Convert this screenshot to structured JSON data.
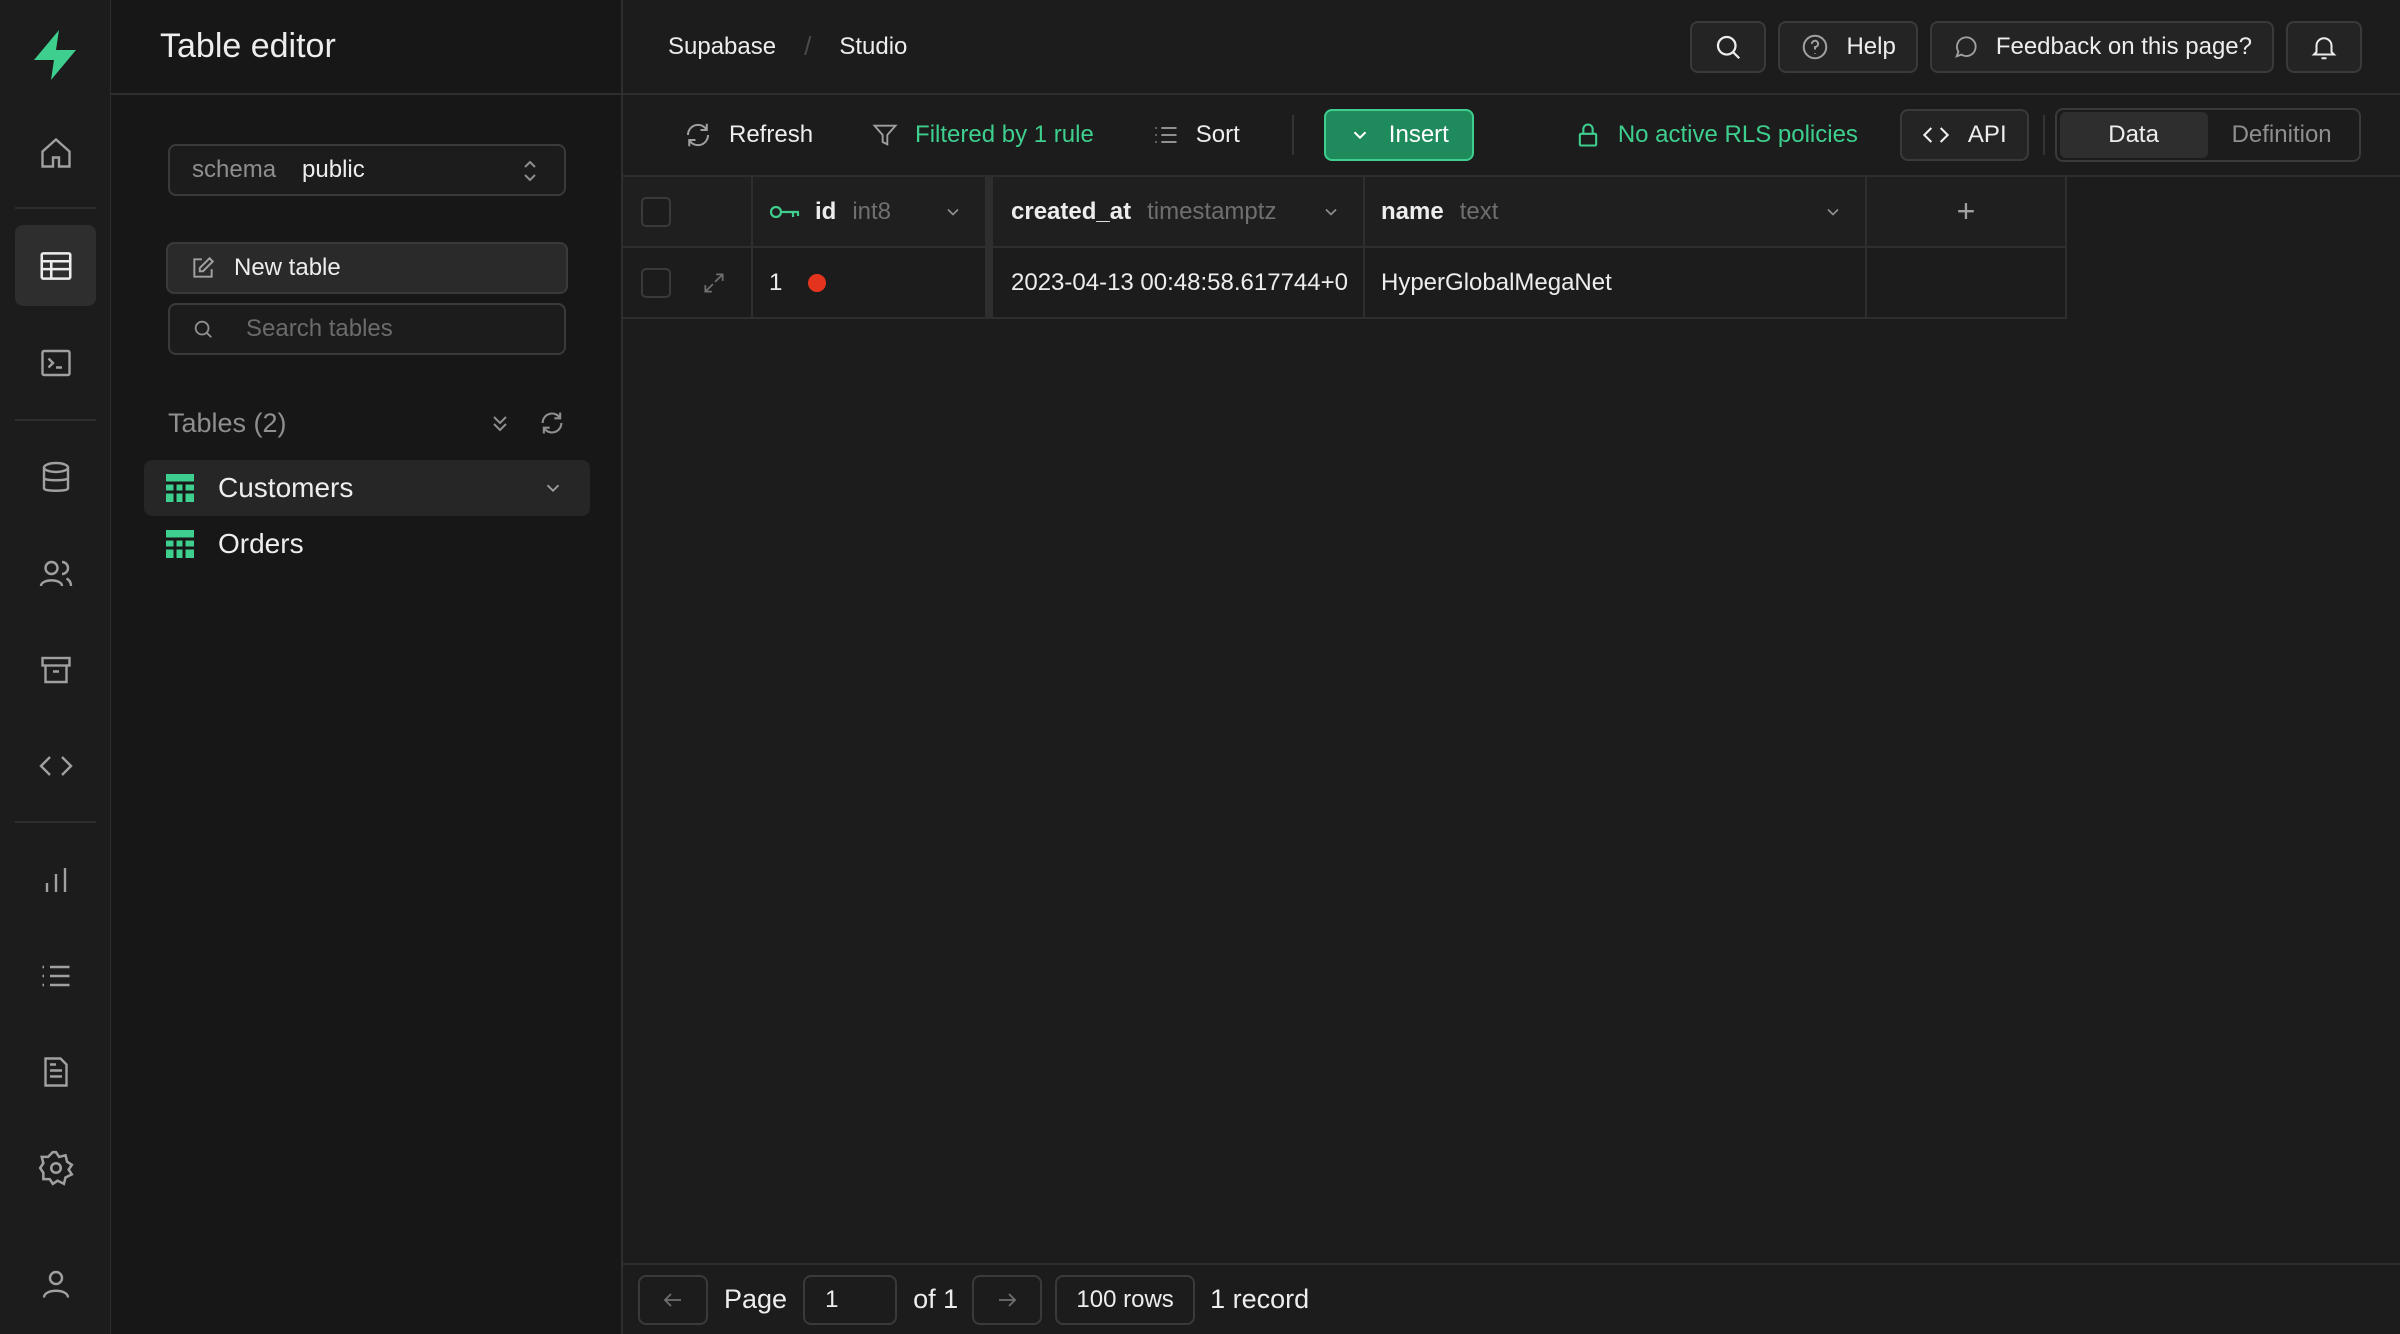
{
  "sidebar": {
    "title": "Table editor",
    "schema_label": "schema",
    "schema_value": "public",
    "new_table_label": "New table",
    "search_placeholder": "Search tables",
    "tables_header": "Tables (2)",
    "tables": [
      {
        "name": "Customers"
      },
      {
        "name": "Orders"
      }
    ]
  },
  "topbar": {
    "crumbs": [
      "Supabase",
      "/",
      "Studio"
    ],
    "help_label": "Help",
    "feedback_label": "Feedback on this page?"
  },
  "toolbar": {
    "refresh_label": "Refresh",
    "filter_label": "Filtered by 1 rule",
    "sort_label": "Sort",
    "insert_label": "Insert",
    "rls_label": "No active RLS policies",
    "api_label": "API",
    "tabs": [
      "Data",
      "Definition"
    ],
    "active_tab": "Data"
  },
  "grid": {
    "columns": [
      {
        "name": "id",
        "type": "int8",
        "primary_key": true
      },
      {
        "name": "created_at",
        "type": "timestamptz"
      },
      {
        "name": "name",
        "type": "text"
      }
    ],
    "add_column_label": "+",
    "rows": [
      {
        "id": "1",
        "created_at": "2023-04-13 00:48:58.617744+0",
        "name": "HyperGlobalMegaNet"
      }
    ]
  },
  "footer": {
    "page_label": "Page",
    "page_value": "1",
    "of_label": "of 1",
    "rows_label": "100 rows",
    "records_label": "1 record"
  },
  "colors": {
    "accent": "#3ecf8e",
    "background": "#1c1c1c",
    "sidebar_bg": "#171717",
    "status_red": "#e5341d"
  }
}
